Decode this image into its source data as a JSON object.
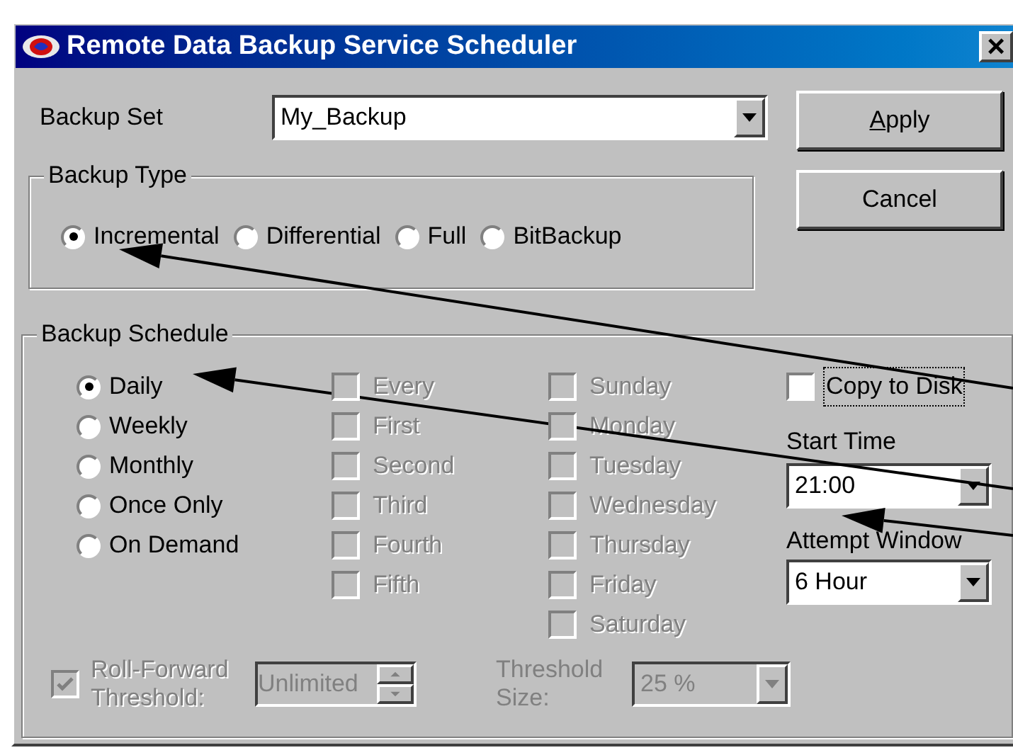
{
  "window": {
    "title": "Remote Data Backup Service Scheduler",
    "close": "×"
  },
  "backup_set": {
    "label": "Backup Set",
    "value": "My_Backup"
  },
  "buttons": [
    {
      "label": "Apply",
      "mnemonic": true
    },
    {
      "label": "Cancel",
      "mnemonic": false
    }
  ],
  "backup_type": {
    "title": "Backup Type",
    "options": [
      {
        "label": "Incremental",
        "selected": true
      },
      {
        "label": "Differential",
        "selected": false
      },
      {
        "label": "Full",
        "selected": false
      },
      {
        "label": "BitBackup",
        "selected": false
      }
    ]
  },
  "backup_schedule": {
    "title": "Backup Schedule",
    "frequency": [
      {
        "label": "Daily",
        "selected": true
      },
      {
        "label": "Weekly",
        "selected": false
      },
      {
        "label": "Monthly",
        "selected": false
      },
      {
        "label": "Once Only",
        "selected": false
      },
      {
        "label": "On Demand",
        "selected": false
      }
    ],
    "occurrence": [
      {
        "label": "Every",
        "checked": false,
        "disabled": true
      },
      {
        "label": "First",
        "checked": false,
        "disabled": true
      },
      {
        "label": "Second",
        "checked": false,
        "disabled": true
      },
      {
        "label": "Third",
        "checked": false,
        "disabled": true
      },
      {
        "label": "Fourth",
        "checked": false,
        "disabled": true
      },
      {
        "label": "Fifth",
        "checked": false,
        "disabled": true
      }
    ],
    "days": [
      {
        "label": "Sunday",
        "checked": false,
        "disabled": true
      },
      {
        "label": "Monday",
        "checked": false,
        "disabled": true
      },
      {
        "label": "Tuesday",
        "checked": false,
        "disabled": true
      },
      {
        "label": "Wednesday",
        "checked": false,
        "disabled": true
      },
      {
        "label": "Thursday",
        "checked": false,
        "disabled": true
      },
      {
        "label": "Friday",
        "checked": false,
        "disabled": true
      },
      {
        "label": "Saturday",
        "checked": false,
        "disabled": true
      }
    ],
    "copy_to_disk": {
      "label": "Copy to Disk",
      "checked": false,
      "disabled": false
    },
    "start_time": {
      "label": "Start Time",
      "value": "21:00"
    },
    "attempt_window": {
      "label": "Attempt Window",
      "value": "6 Hour"
    },
    "roll_forward": {
      "label_lines": [
        "Roll-Forward",
        "Threshold:"
      ],
      "checked": true,
      "disabled": true,
      "value": "Unlimited"
    },
    "threshold_size": {
      "label_lines": [
        "Threshold",
        "Size:"
      ],
      "value": "25 %",
      "disabled": true
    }
  }
}
